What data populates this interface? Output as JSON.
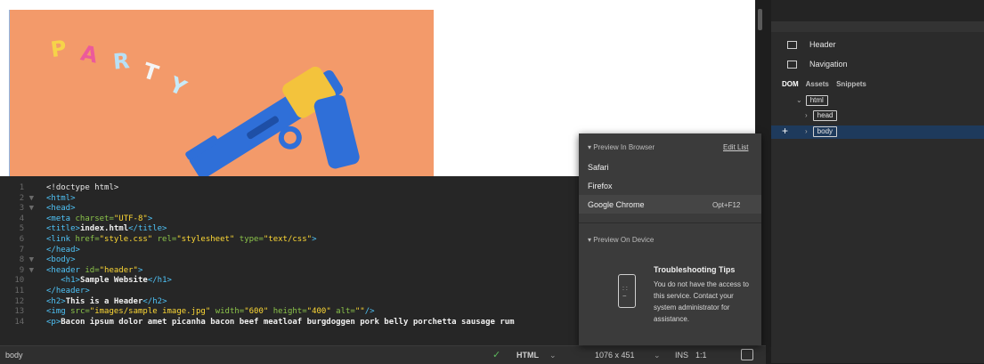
{
  "design": {
    "photo_letters": [
      "P",
      "A",
      "R",
      "T",
      "Y"
    ]
  },
  "code": {
    "lines": [
      {
        "n": "1",
        "fold": "",
        "html": "&lt;!doctype html&gt;"
      },
      {
        "n": "2",
        "fold": "▼",
        "html": "<span class='t'>&lt;html&gt;</span>"
      },
      {
        "n": "3",
        "fold": "▼",
        "html": "<span class='t'>&lt;head&gt;</span>"
      },
      {
        "n": "4",
        "fold": "",
        "html": "<span class='t'>&lt;meta</span> <span class='a'>charset=</span><span class='s'>\"UTF-8\"</span><span class='t'>&gt;</span>"
      },
      {
        "n": "5",
        "fold": "",
        "html": "<span class='t'>&lt;title&gt;</span><span class='w'>index.html</span><span class='t'>&lt;/title&gt;</span>"
      },
      {
        "n": "6",
        "fold": "",
        "html": "<span class='t'>&lt;link</span> <span class='a'>href=</span><span class='s'>\"style.css\"</span> <span class='a'>rel=</span><span class='s'>\"stylesheet\"</span> <span class='a'>type=</span><span class='s'>\"text/css\"</span><span class='t'>&gt;</span>"
      },
      {
        "n": "7",
        "fold": "",
        "html": "<span class='t'>&lt;/head&gt;</span>"
      },
      {
        "n": "8",
        "fold": "▼",
        "html": "<span class='t'>&lt;body&gt;</span>"
      },
      {
        "n": "9",
        "fold": "▼",
        "html": "<span class='t'>&lt;header</span> <span class='a'>id=</span><span class='s'>\"header\"</span><span class='t'>&gt;</span>"
      },
      {
        "n": "10",
        "fold": "",
        "html": "   <span class='t'>&lt;h1&gt;</span><span class='w'>Sample Website</span><span class='t'>&lt;/h1&gt;</span>"
      },
      {
        "n": "11",
        "fold": "",
        "html": "<span class='t'>&lt;/header&gt;</span>"
      },
      {
        "n": "12",
        "fold": "",
        "html": "<span class='t'>&lt;h2&gt;</span><span class='w'>This is a Header</span><span class='t'>&lt;/h2&gt;</span>"
      },
      {
        "n": "13",
        "fold": "",
        "html": "<span class='t'>&lt;img</span> <span class='a'>src=</span><span class='s'>\"images/sample image.jpg\"</span> <span class='a'>width=</span><span class='s'>\"600\"</span> <span class='a'>height=</span><span class='s'>\"400\"</span> <span class='a'>alt=</span><span class='s'>\"\"</span><span class='t'>/&gt;</span>"
      },
      {
        "n": "14",
        "fold": "",
        "html": "<span class='t'>&lt;p&gt;</span><span class='w'>Bacon ipsum dolor amet picanha bacon beef meatloaf burgdoggen pork belly porchetta sausage rum</span>"
      }
    ]
  },
  "status": {
    "tag": "body",
    "mode": "HTML",
    "size": "1076 x 451",
    "ins": "INS",
    "pos": "1:1"
  },
  "right": {
    "insert_items": [
      {
        "label": "Header",
        "icon": "header-icon"
      },
      {
        "label": "Navigation",
        "icon": "navigation-icon"
      }
    ],
    "tabs": [
      "DOM",
      "Assets",
      "Snippets"
    ],
    "dom_tree": {
      "html": "html",
      "head": "head",
      "body": "body"
    }
  },
  "dropdown": {
    "preview_browser": "Preview In Browser",
    "edit_list": "Edit List",
    "browsers": [
      "Safari",
      "Firefox",
      "Google Chrome"
    ],
    "chrome_shortcut": "Opt+F12",
    "preview_device": "Preview On Device",
    "tips_title": "Troubleshooting Tips",
    "tips_text": "You do not have the access to this service. Contact your system administrator for assistance."
  }
}
